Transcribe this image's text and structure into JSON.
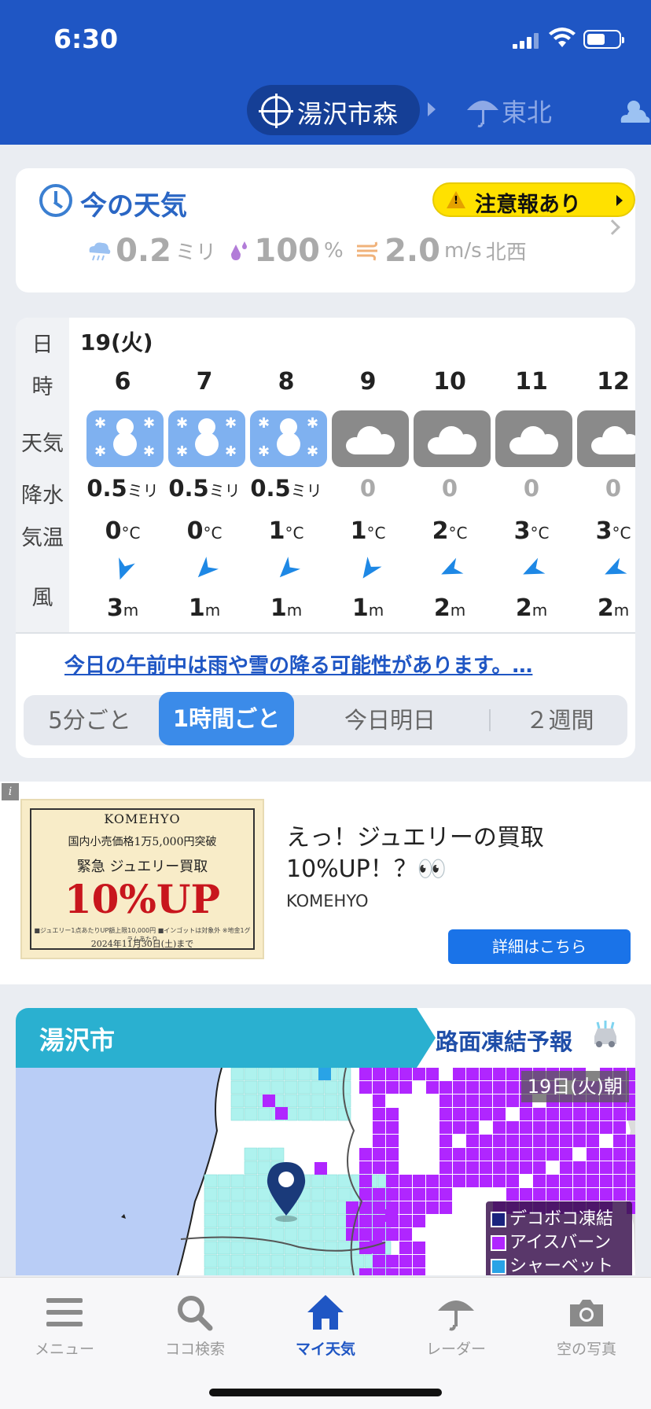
{
  "status": {
    "time": "6:30"
  },
  "location": {
    "name": "湯沢市森",
    "region": "東北"
  },
  "now": {
    "title": "今の天気",
    "alert": "注意報あり",
    "precip_value": "0.2",
    "precip_unit": "ミリ",
    "humidity_value": "100",
    "humidity_unit": "%",
    "wind_value": "2.0",
    "wind_unit": "m/s",
    "wind_dir": "北西"
  },
  "forecast": {
    "date": "19(火)",
    "row_labels": {
      "day": "日",
      "hour": "時",
      "weather": "天気",
      "precip": "降水",
      "temp": "気温",
      "wind": "風"
    },
    "precip_unit": "ミリ",
    "temp_unit": "°C",
    "wind_unit": "m",
    "hours": [
      {
        "hour": "6",
        "weather": "snow",
        "precip": "0.5",
        "temp": "0",
        "wind": "3",
        "wind_dir_deg": 200
      },
      {
        "hour": "7",
        "weather": "snow",
        "precip": "0.5",
        "temp": "0",
        "wind": "1",
        "wind_dir_deg": 225
      },
      {
        "hour": "8",
        "weather": "snow",
        "precip": "0.5",
        "temp": "1",
        "wind": "1",
        "wind_dir_deg": 225
      },
      {
        "hour": "9",
        "weather": "cloudy",
        "precip": "0",
        "temp": "1",
        "wind": "1",
        "wind_dir_deg": 215
      },
      {
        "hour": "10",
        "weather": "cloudy",
        "precip": "0",
        "temp": "2",
        "wind": "2",
        "wind_dir_deg": 245
      },
      {
        "hour": "11",
        "weather": "cloudy",
        "precip": "0",
        "temp": "3",
        "wind": "2",
        "wind_dir_deg": 245
      },
      {
        "hour": "12",
        "weather": "cloudy",
        "precip": "0",
        "temp": "3",
        "wind": "2",
        "wind_dir_deg": 245
      }
    ],
    "comment": "今日の午前中は雨や雪の降る可能性があります。…",
    "tabs": [
      "5分ごと",
      "1時間ごと",
      "今日明日",
      "２週間"
    ],
    "active_tab": 1
  },
  "ad": {
    "info_icon": "i",
    "image_brand": "KOMEHYO",
    "image_line1": "国内小売価格1万5,000円突破",
    "image_line2": "緊急 ジュエリー買取",
    "image_big": "10%UP",
    "image_fine": "■ジュエリー1点あたりUP額上限10,000円 ■インゴットは対象外 ※地金1グラムあたり",
    "image_date": "2024年11月30日(土)まで",
    "title": "えっ！ジュエリーの買取10%UP！？👀",
    "sponsor": "KOMEHYO",
    "cta": "詳細はこちら"
  },
  "road": {
    "city": "湯沢市",
    "title": "路面凍結予報",
    "map_date": "19日(火)朝",
    "legend": [
      {
        "label": "デコボコ凍結",
        "color": "#1a237e"
      },
      {
        "label": "アイスバーン",
        "color": "#b026ff"
      },
      {
        "label": "シャーベット",
        "color": "#29a3e6"
      }
    ]
  },
  "nav": [
    {
      "label": "メニュー",
      "icon": "menu-icon"
    },
    {
      "label": "ココ検索",
      "icon": "search-icon"
    },
    {
      "label": "マイ天気",
      "icon": "home-icon"
    },
    {
      "label": "レーダー",
      "icon": "umbrella-icon"
    },
    {
      "label": "空の写真",
      "icon": "camera-icon"
    }
  ],
  "colors": {
    "header": "#1f56c4",
    "accent": "#3b8be9",
    "alert": "#ffe100",
    "snow_tile": "#7fb1f0",
    "cloud_tile": "#8a8a8a",
    "road_header": "#2ab0d0",
    "ice_purple": "#b026ff",
    "frost_cyan": "#aef2ee"
  }
}
